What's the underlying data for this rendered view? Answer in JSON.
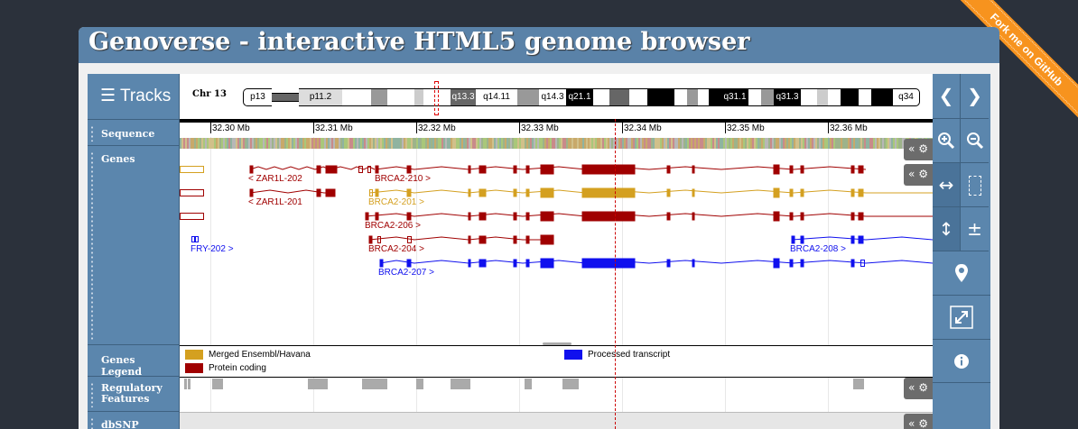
{
  "title": "Genoverse - interactive HTML5 genome browser",
  "ribbon_text": "Fork me on GitHub",
  "sidebar": {
    "tracks_label": "Tracks",
    "menu_icon": "hamburger-icon",
    "track_labels": [
      "Sequence",
      "Genes",
      "Genes Legend",
      "Regulatory Features",
      "dbSNP"
    ]
  },
  "karyotype": {
    "chromosome": "Chr 13",
    "bands": [
      "p13",
      "p11.2",
      "q13.3",
      "q14.11",
      "q14.3",
      "q21.1",
      "q31.1",
      "q31.3",
      "q34"
    ]
  },
  "scale_ticks": [
    "32.30 Mb",
    "32.31 Mb",
    "32.32 Mb",
    "32.33 Mb",
    "32.34 Mb",
    "32.35 Mb",
    "32.36 Mb"
  ],
  "transcripts": [
    "< ZAR1L-202",
    "BRCA2-210 >",
    "< ZAR1L-201",
    "BRCA2-201 >",
    "BRCA2-206 >",
    "FRY-202 >",
    "BRCA2-204 >",
    "BRCA2-208 >",
    "BRCA2-207 >"
  ],
  "legend": {
    "items": [
      {
        "label": "Merged Ensembl/Havana",
        "color": "#d4a020"
      },
      {
        "label": "Protein coding",
        "color": "#a00000"
      },
      {
        "label": "Processed transcript",
        "color": "#1010ee"
      }
    ]
  },
  "track_control": {
    "label": "«"
  },
  "controls": {
    "icons": [
      "chevron-left-icon",
      "chevron-right-icon",
      "zoom-in-icon",
      "zoom-out-icon",
      "drag-horizontal-icon",
      "select-region-icon",
      "resize-vertical-icon",
      "plus-minus-icon",
      "map-marker-icon",
      "fullscreen-icon",
      "info-icon"
    ]
  },
  "colors": {
    "panel_header": "#5a82a8",
    "merged": "#d4a020",
    "protein_coding": "#a00000",
    "processed": "#1010ee",
    "ribbon": "#f7931e"
  }
}
